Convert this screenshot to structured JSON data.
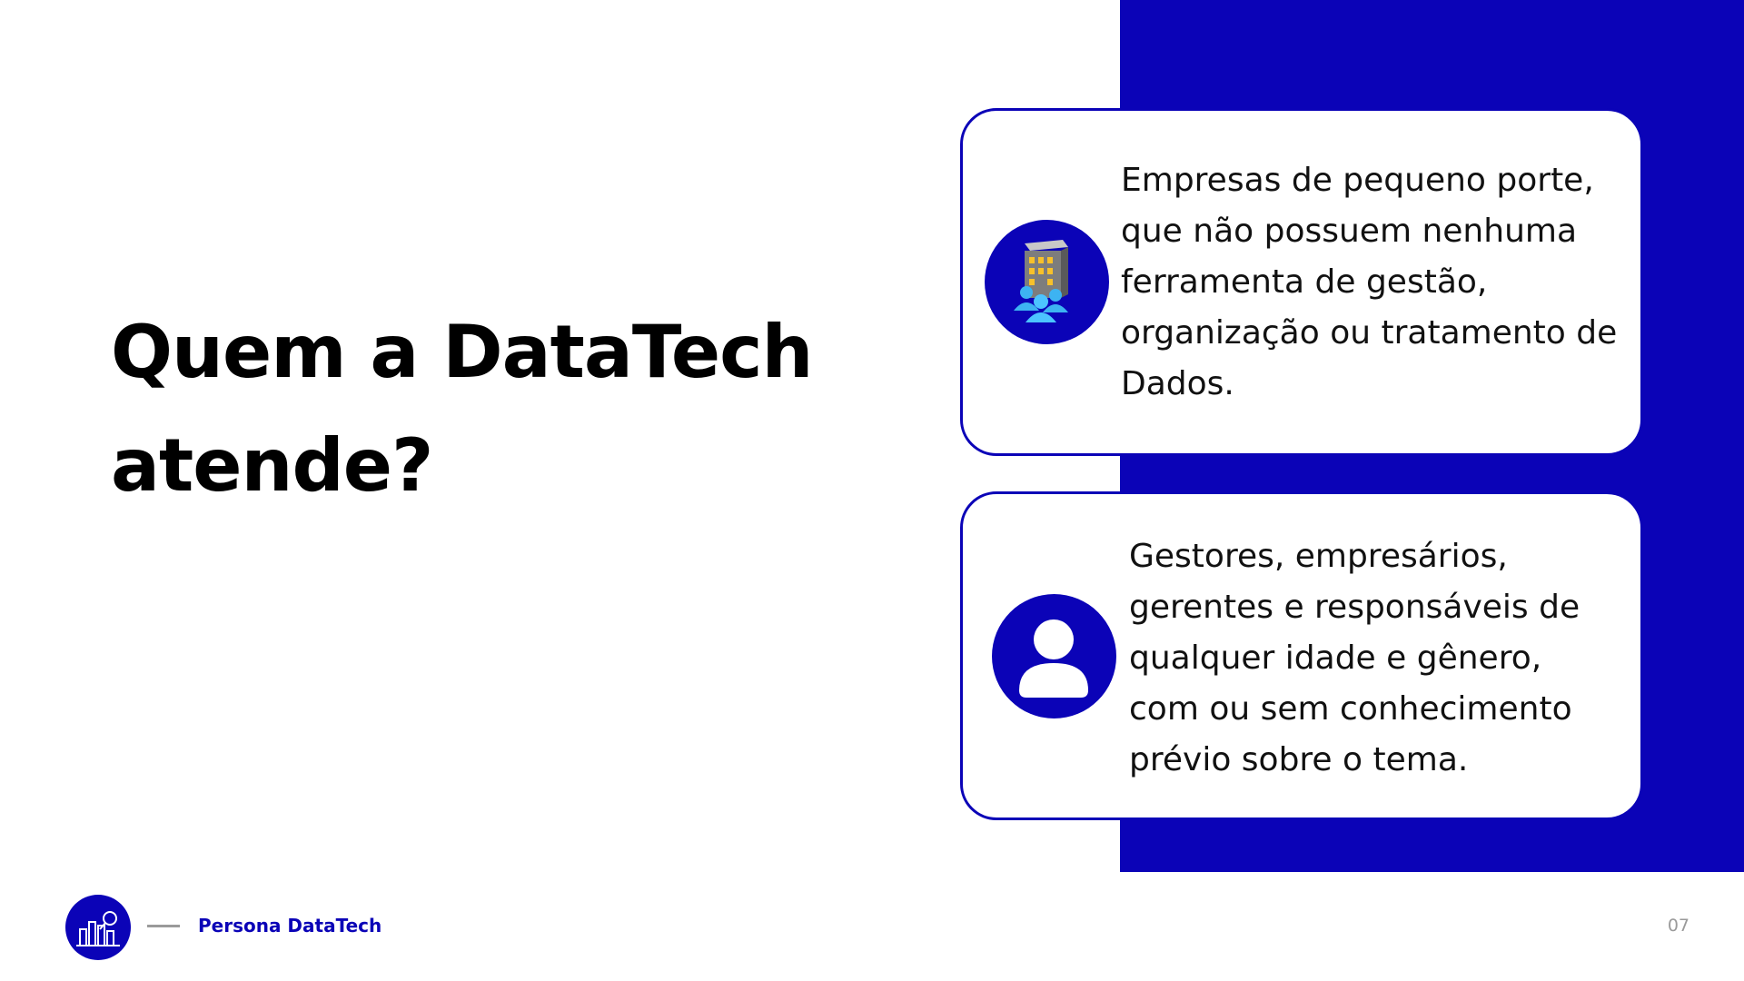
{
  "slide": {
    "title": "Quem a DataTech atende?",
    "page_number": "07"
  },
  "cards": [
    {
      "icon": "office-building-people-icon",
      "text": "Empresas de pequeno porte, que não possuem nenhuma ferramenta de gestão, organização ou tratamento de Dados."
    },
    {
      "icon": "user-icon",
      "text": "Gestores, empresários, gerentes e responsáveis de qualquer idade e gênero, com ou sem conhecimento prévio sobre o tema."
    }
  ],
  "footer": {
    "logo_icon": "analytics-chart-icon",
    "label": "Persona DataTech"
  },
  "colors": {
    "accent": "#0b03b7",
    "text": "#000000",
    "muted": "#9a9a9a"
  }
}
